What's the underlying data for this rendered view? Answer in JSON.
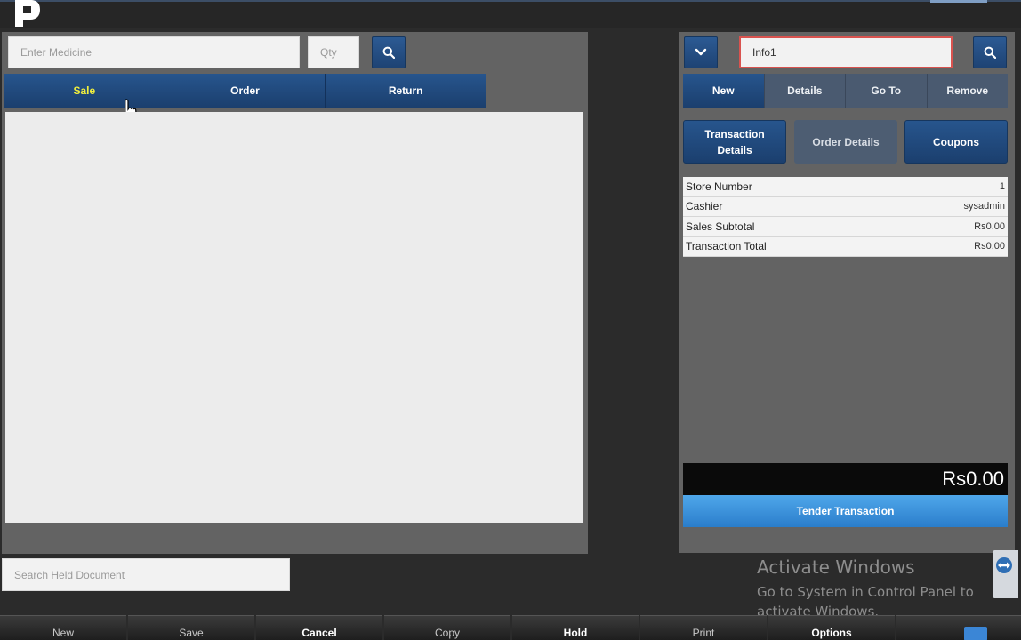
{
  "left": {
    "medicine_placeholder": "Enter Medicine",
    "qty_placeholder": "Qty",
    "tabs": [
      {
        "label": "Sale"
      },
      {
        "label": "Order"
      },
      {
        "label": "Return"
      }
    ],
    "held_placeholder": "Search Held Document"
  },
  "right": {
    "info_value": "Info1",
    "tabs": [
      {
        "label": "New"
      },
      {
        "label": "Details"
      },
      {
        "label": "Go To"
      },
      {
        "label": "Remove"
      }
    ],
    "detail_buttons": {
      "transaction_details_line1": "Transaction",
      "transaction_details_line2": "Details",
      "order_details": "Order Details",
      "coupons": "Coupons"
    },
    "summary": [
      {
        "label": "Store Number",
        "value": "1"
      },
      {
        "label": "Cashier",
        "value": "sysadmin"
      },
      {
        "label": "Sales Subtotal",
        "value": "Rs0.00"
      },
      {
        "label": "Transaction Total",
        "value": "Rs0.00"
      }
    ],
    "total": "Rs0.00",
    "tender_label": "Tender Transaction"
  },
  "watermark": {
    "title": "Activate Windows",
    "subtitle": "Go to System in Control Panel to activate Windows."
  },
  "footer": {
    "buttons": [
      {
        "label": "New"
      },
      {
        "label": "Save"
      },
      {
        "label": "Cancel"
      },
      {
        "label": "Copy"
      },
      {
        "label": "Hold"
      },
      {
        "label": "Print"
      },
      {
        "label": "Options"
      }
    ]
  },
  "colors": {
    "accent_blue": "#1e4374",
    "active_tab_text": "#f1ef3d",
    "tender_blue": "#2a7dcb",
    "info_border": "#d9534f"
  },
  "icons": [
    "app-logo-icon",
    "search-icon",
    "chevron-down-icon",
    "pointer-cursor-icon",
    "teamviewer-icon"
  ]
}
